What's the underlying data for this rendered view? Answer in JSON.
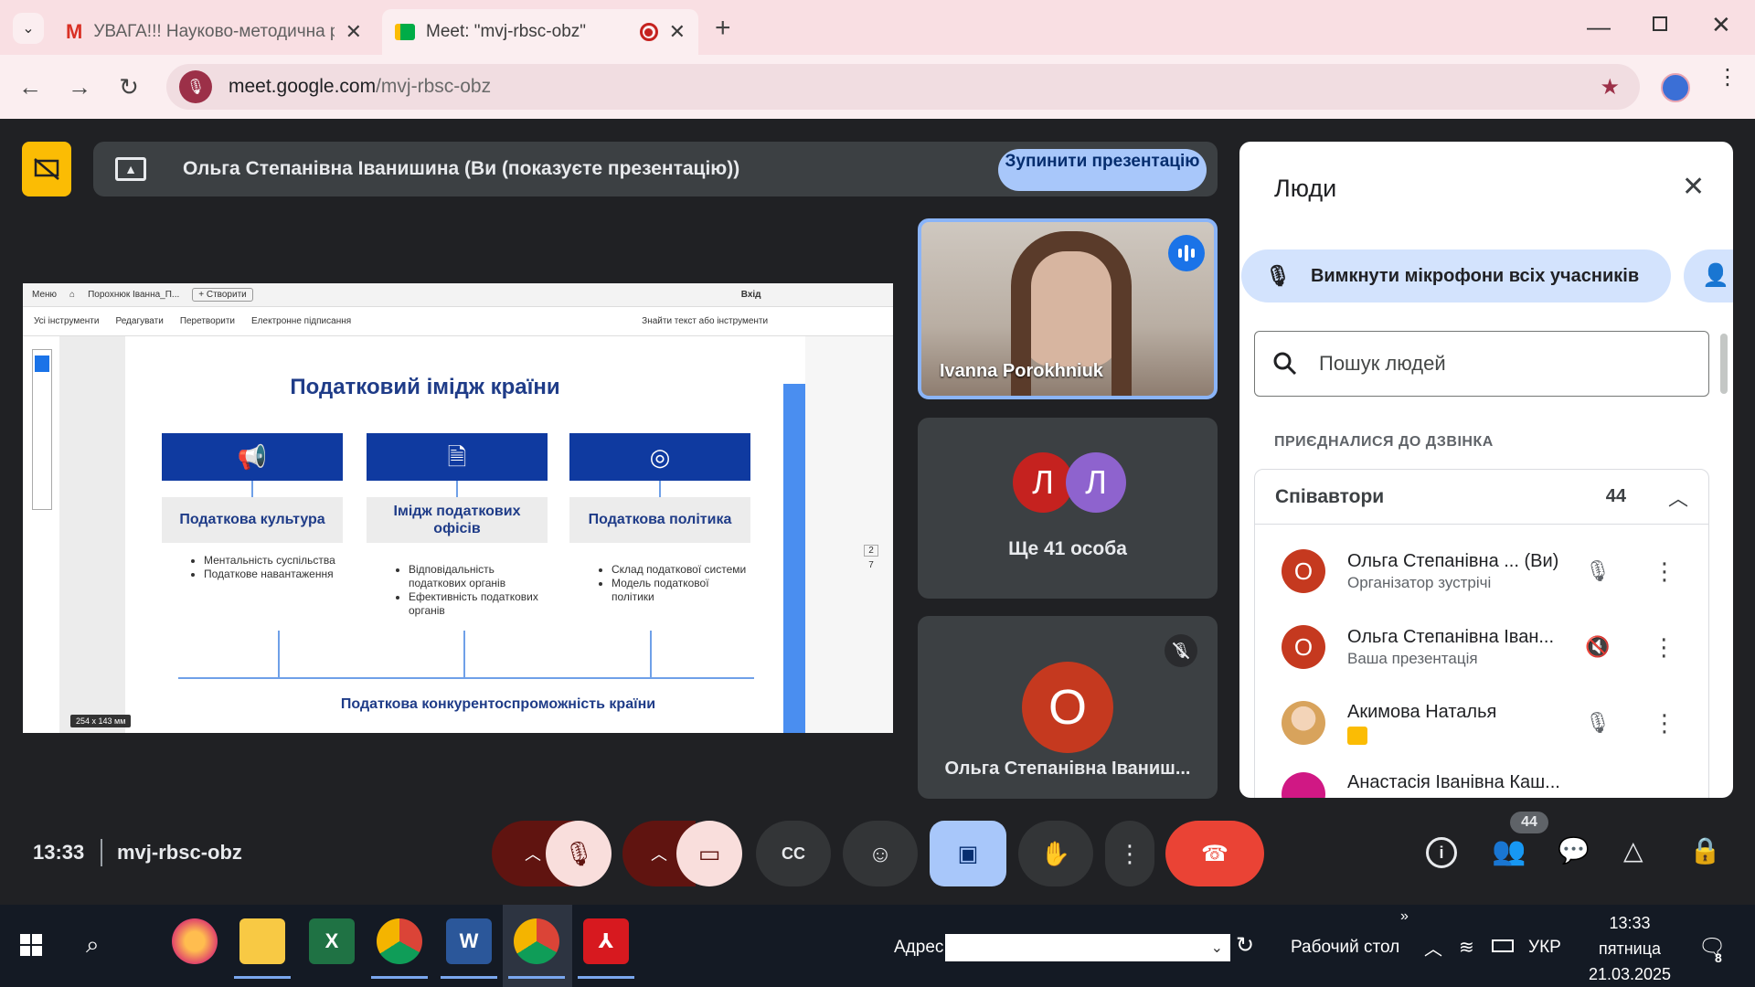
{
  "browser": {
    "tabs": [
      {
        "title": "УВАГА!!! Науково-методична р",
        "icon": "gmail-icon"
      },
      {
        "title": "Meet: \"mvj-rbsc-obz\"",
        "icon": "meet-icon"
      }
    ],
    "url_domain": "meet.google.com",
    "url_path": "/mvj-rbsc-obz"
  },
  "meet": {
    "presenting_text": "Ольга Степанівна Іванишина (Ви (показуєте презентацію))",
    "stop_button": "Зупинити презентацію",
    "slide": {
      "toolbar_items": [
        "Меню",
        "Порохнюк Іванна_П...",
        "+ Створити",
        "Вхід"
      ],
      "menu_items": [
        "Усі інструменти",
        "Редагувати",
        "Перетворити",
        "Електронне підписання"
      ],
      "search_text": "Знайти текст або інструменти",
      "title": "Податковий імідж країни",
      "columns": [
        {
          "heading": "Податкова культура",
          "bullets": [
            "Ментальність суспільства",
            "Податкове навантаження"
          ]
        },
        {
          "heading": "Імідж податкових офісів",
          "bullets": [
            "Відповідальність податкових органів",
            "Ефективність податкових органів"
          ]
        },
        {
          "heading": "Податкова політика",
          "bullets": [
            "Склад податкової системи",
            "Модель податкової політики"
          ]
        }
      ],
      "footer": "Податкова конкурентоспроможність країни",
      "size_badge": "254 x 143 мм",
      "page_num": "2",
      "page_total": "7"
    },
    "tiles": {
      "speaker_name": "Ivanna Porokhniuk",
      "group_avatars": [
        "Л",
        "Л"
      ],
      "group_label": "Ще 41 особа",
      "self_avatar": "О",
      "self_name": "Ольга Степанівна Іваниш..."
    },
    "meeting_time": "13:33",
    "meeting_code": "mvj-rbsc-obz",
    "participants_badge": "44"
  },
  "people_panel": {
    "title": "Люди",
    "mute_all": "Вимкнути мікрофони всіх учасників",
    "search_placeholder": "Пошук людей",
    "section_label": "ПРИЄДНАЛИСЯ ДО ДЗВІНКА",
    "group_label": "Співавтори",
    "group_count": "44",
    "people": [
      {
        "avatar": "О",
        "name": "Ольга Степанівна ... (Ви)",
        "role": "Організатор зустрічі"
      },
      {
        "avatar": "О",
        "name": "Ольга Степанівна Іван...",
        "role": "Ваша презентація"
      },
      {
        "avatar": "",
        "name": "Акимова Наталья",
        "role": ""
      },
      {
        "avatar": "",
        "name": "Анастасія Іванівна Каш...",
        "role": ""
      }
    ]
  },
  "taskbar": {
    "address_label": "Адрес",
    "desktop_label": "Рабочий стол",
    "lang": "УКР",
    "time": "13:33",
    "day": "пятница",
    "date": "21.03.2025",
    "notif_count": "8"
  },
  "colors": {
    "meet_bg": "#202124",
    "tile": "#3c4043",
    "accent": "#a8c7fa",
    "end_call": "#ea4335",
    "avatar_red": "#c5221f"
  }
}
